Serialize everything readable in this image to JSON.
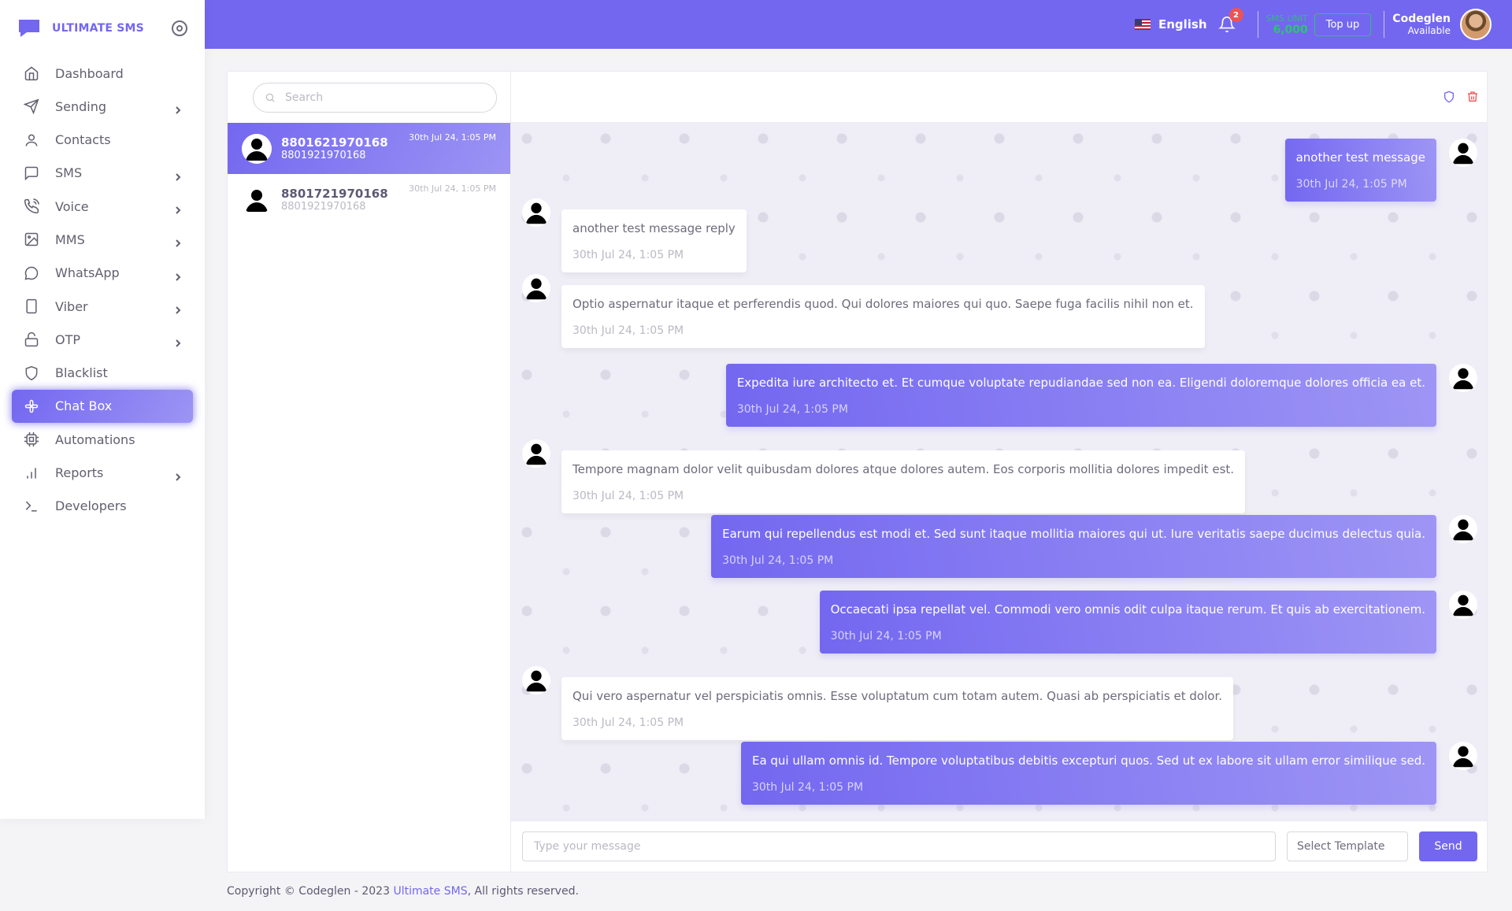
{
  "brand": {
    "name": "ULTIMATE SMS"
  },
  "sidebar": {
    "items": [
      {
        "label": "Dashboard",
        "icon": "home-icon",
        "chevron": false
      },
      {
        "label": "Sending",
        "icon": "send-icon",
        "chevron": true
      },
      {
        "label": "Contacts",
        "icon": "user-icon",
        "chevron": false
      },
      {
        "label": "SMS",
        "icon": "message-square-icon",
        "chevron": true
      },
      {
        "label": "Voice",
        "icon": "phone-call-icon",
        "chevron": true
      },
      {
        "label": "MMS",
        "icon": "image-icon",
        "chevron": true
      },
      {
        "label": "WhatsApp",
        "icon": "message-circle-icon",
        "chevron": true
      },
      {
        "label": "Viber",
        "icon": "smartphone-icon",
        "chevron": true
      },
      {
        "label": "OTP",
        "icon": "unlock-icon",
        "chevron": true
      },
      {
        "label": "Blacklist",
        "icon": "shield-icon",
        "chevron": false
      },
      {
        "label": "Chat Box",
        "icon": "slack-icon",
        "chevron": false,
        "active": true
      },
      {
        "label": "Automations",
        "icon": "cpu-icon",
        "chevron": false
      },
      {
        "label": "Reports",
        "icon": "bar-chart-icon",
        "chevron": true
      },
      {
        "label": "Developers",
        "icon": "terminal-icon",
        "chevron": false
      }
    ]
  },
  "header": {
    "language": "English",
    "notification_count": "2",
    "sms_unit_label": "SMS UNIT",
    "sms_unit_value": "6,000",
    "topup_label": "Top up",
    "user_name": "Codeglen",
    "user_status": "Available"
  },
  "chat_list": {
    "search_placeholder": "Search",
    "contacts": [
      {
        "name": "8801621970168",
        "sub": "8801921970168",
        "time": "30th Jul 24, 1:05 PM",
        "active": true
      },
      {
        "name": "8801721970168",
        "sub": "8801921970168",
        "time": "30th Jul 24, 1:05 PM",
        "active": false
      }
    ]
  },
  "messages": [
    {
      "dir": "out",
      "text": "another test message",
      "time": "30th Jul 24, 1:05 PM"
    },
    {
      "dir": "in",
      "text": "another test message reply",
      "time": "30th Jul 24, 1:05 PM"
    },
    {
      "dir": "in",
      "text": "Optio aspernatur itaque et perferendis quod. Qui dolores maiores qui quo. Saepe fuga facilis nihil non et.",
      "time": "30th Jul 24, 1:05 PM"
    },
    {
      "dir": "out",
      "text": "Expedita iure architecto et. Et cumque voluptate repudiandae sed non ea. Eligendi doloremque dolores officia ea et.",
      "time": "30th Jul 24, 1:05 PM"
    },
    {
      "dir": "in",
      "text": "Tempore magnam dolor velit quibusdam dolores atque dolores autem. Eos corporis mollitia dolores impedit est.",
      "time": "30th Jul 24, 1:05 PM"
    },
    {
      "dir": "out",
      "text": "Earum qui repellendus est modi et. Sed sunt itaque mollitia maiores qui ut. Iure veritatis saepe ducimus delectus quia.",
      "time": "30th Jul 24, 1:05 PM"
    },
    {
      "dir": "out",
      "text": "Occaecati ipsa repellat vel. Commodi vero omnis odit culpa itaque rerum. Et quis ab exercitationem.",
      "time": "30th Jul 24, 1:05 PM"
    },
    {
      "dir": "in",
      "text": "Qui vero aspernatur vel perspiciatis omnis. Esse voluptatum cum totam autem. Quasi ab perspiciatis et dolor.",
      "time": "30th Jul 24, 1:05 PM"
    },
    {
      "dir": "out",
      "text": "Ea qui ullam omnis id. Tempore voluptatibus debitis excepturi quos. Sed ut ex labore sit ullam error similique sed.",
      "time": "30th Jul 24, 1:05 PM"
    }
  ],
  "composer": {
    "placeholder": "Type your message",
    "template_label": "Select Template",
    "send_label": "Send"
  },
  "footer": {
    "prefix": "Copyright © Codeglen - 2023",
    "link": "Ultimate SMS",
    "suffix": ", All rights reserved."
  },
  "colors": {
    "accent": "#7367f0",
    "success": "#28c76f",
    "danger": "#ea5455"
  }
}
